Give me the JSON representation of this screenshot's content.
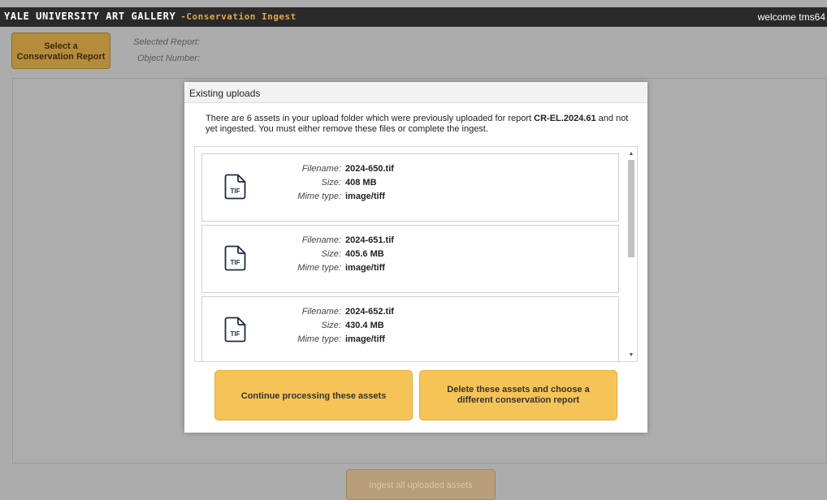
{
  "header": {
    "brand": "YALE UNIVERSITY ART GALLERY",
    "separator": "-",
    "app_name": "Conservation Ingest",
    "welcome": "welcome tms64"
  },
  "toolbar": {
    "select_report_line1": "Select a",
    "select_report_line2": "Conservation Report",
    "selected_report_label": "Selected Report:",
    "object_number_label": "Object Number:"
  },
  "modal": {
    "title": "Existing uploads",
    "message_pre": "There are 6 assets in your upload folder which were previously uploaded for report ",
    "report_id": "CR-EL.2024.61",
    "message_post": " and not yet ingested. You must either remove these files or complete the ingest.",
    "files": [
      {
        "icon": "tif-file-icon",
        "icon_label": "TIF",
        "filename_label": "Filename:",
        "filename": "2024-650.tif",
        "size_label": "Size:",
        "size": "408 MB",
        "mime_label": "Mime type:",
        "mime": "image/tiff"
      },
      {
        "icon": "tif-file-icon",
        "icon_label": "TIF",
        "filename_label": "Filename:",
        "filename": "2024-651.tif",
        "size_label": "Size:",
        "size": "405.6 MB",
        "mime_label": "Mime type:",
        "mime": "image/tiff"
      },
      {
        "icon": "tif-file-icon",
        "icon_label": "TIF",
        "filename_label": "Filename:",
        "filename": "2024-652.tif",
        "size_label": "Size:",
        "size": "430.4 MB",
        "mime_label": "Mime type:",
        "mime": "image/tiff"
      }
    ],
    "continue_label": "Continue processing these assets",
    "delete_label": "Delete these assets and choose a different conservation report"
  },
  "footer": {
    "ingest_label": "Ingest all uploaded assets"
  },
  "colors": {
    "topbar": "#2a2a2a",
    "accent": "#f6c456",
    "brand_orange": "#e6a64a"
  }
}
